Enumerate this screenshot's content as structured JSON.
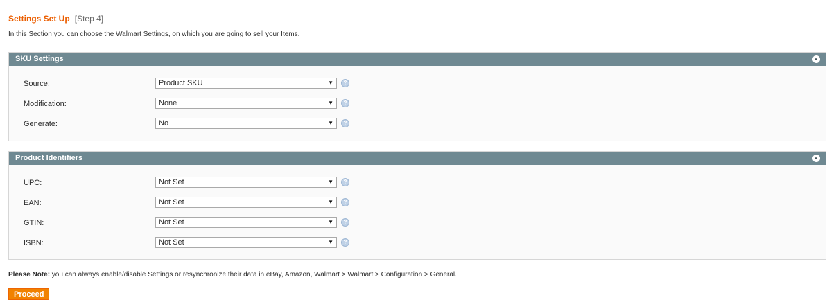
{
  "header": {
    "title": "Settings Set Up",
    "step": "[Step 4]",
    "intro": "In this Section you can choose the Walmart Settings, on which you are going to sell your Items."
  },
  "sku_settings": {
    "title": "SKU Settings",
    "rows": [
      {
        "label": "Source:",
        "value": "Product SKU"
      },
      {
        "label": "Modification:",
        "value": "None"
      },
      {
        "label": "Generate:",
        "value": "No"
      }
    ]
  },
  "product_identifiers": {
    "title": "Product Identifiers",
    "rows": [
      {
        "label": "UPC:",
        "value": "Not Set"
      },
      {
        "label": "EAN:",
        "value": "Not Set"
      },
      {
        "label": "GTIN:",
        "value": "Not Set"
      },
      {
        "label": "ISBN:",
        "value": "Not Set"
      }
    ]
  },
  "footer": {
    "note_strong": "Please Note:",
    "note_text": " you can always enable/disable Settings or resynchronize their data in eBay, Amazon, Walmart > Walmart > Configuration > General.",
    "proceed_label": "Proceed"
  },
  "colors": {
    "title": "#eb5e00",
    "section_header": "#6f8992",
    "button": "#f18200"
  },
  "icons": {
    "collapse": "chevron-up-circle-icon",
    "help": "help-circle-icon",
    "select_arrow": "dropdown-arrow-icon"
  }
}
